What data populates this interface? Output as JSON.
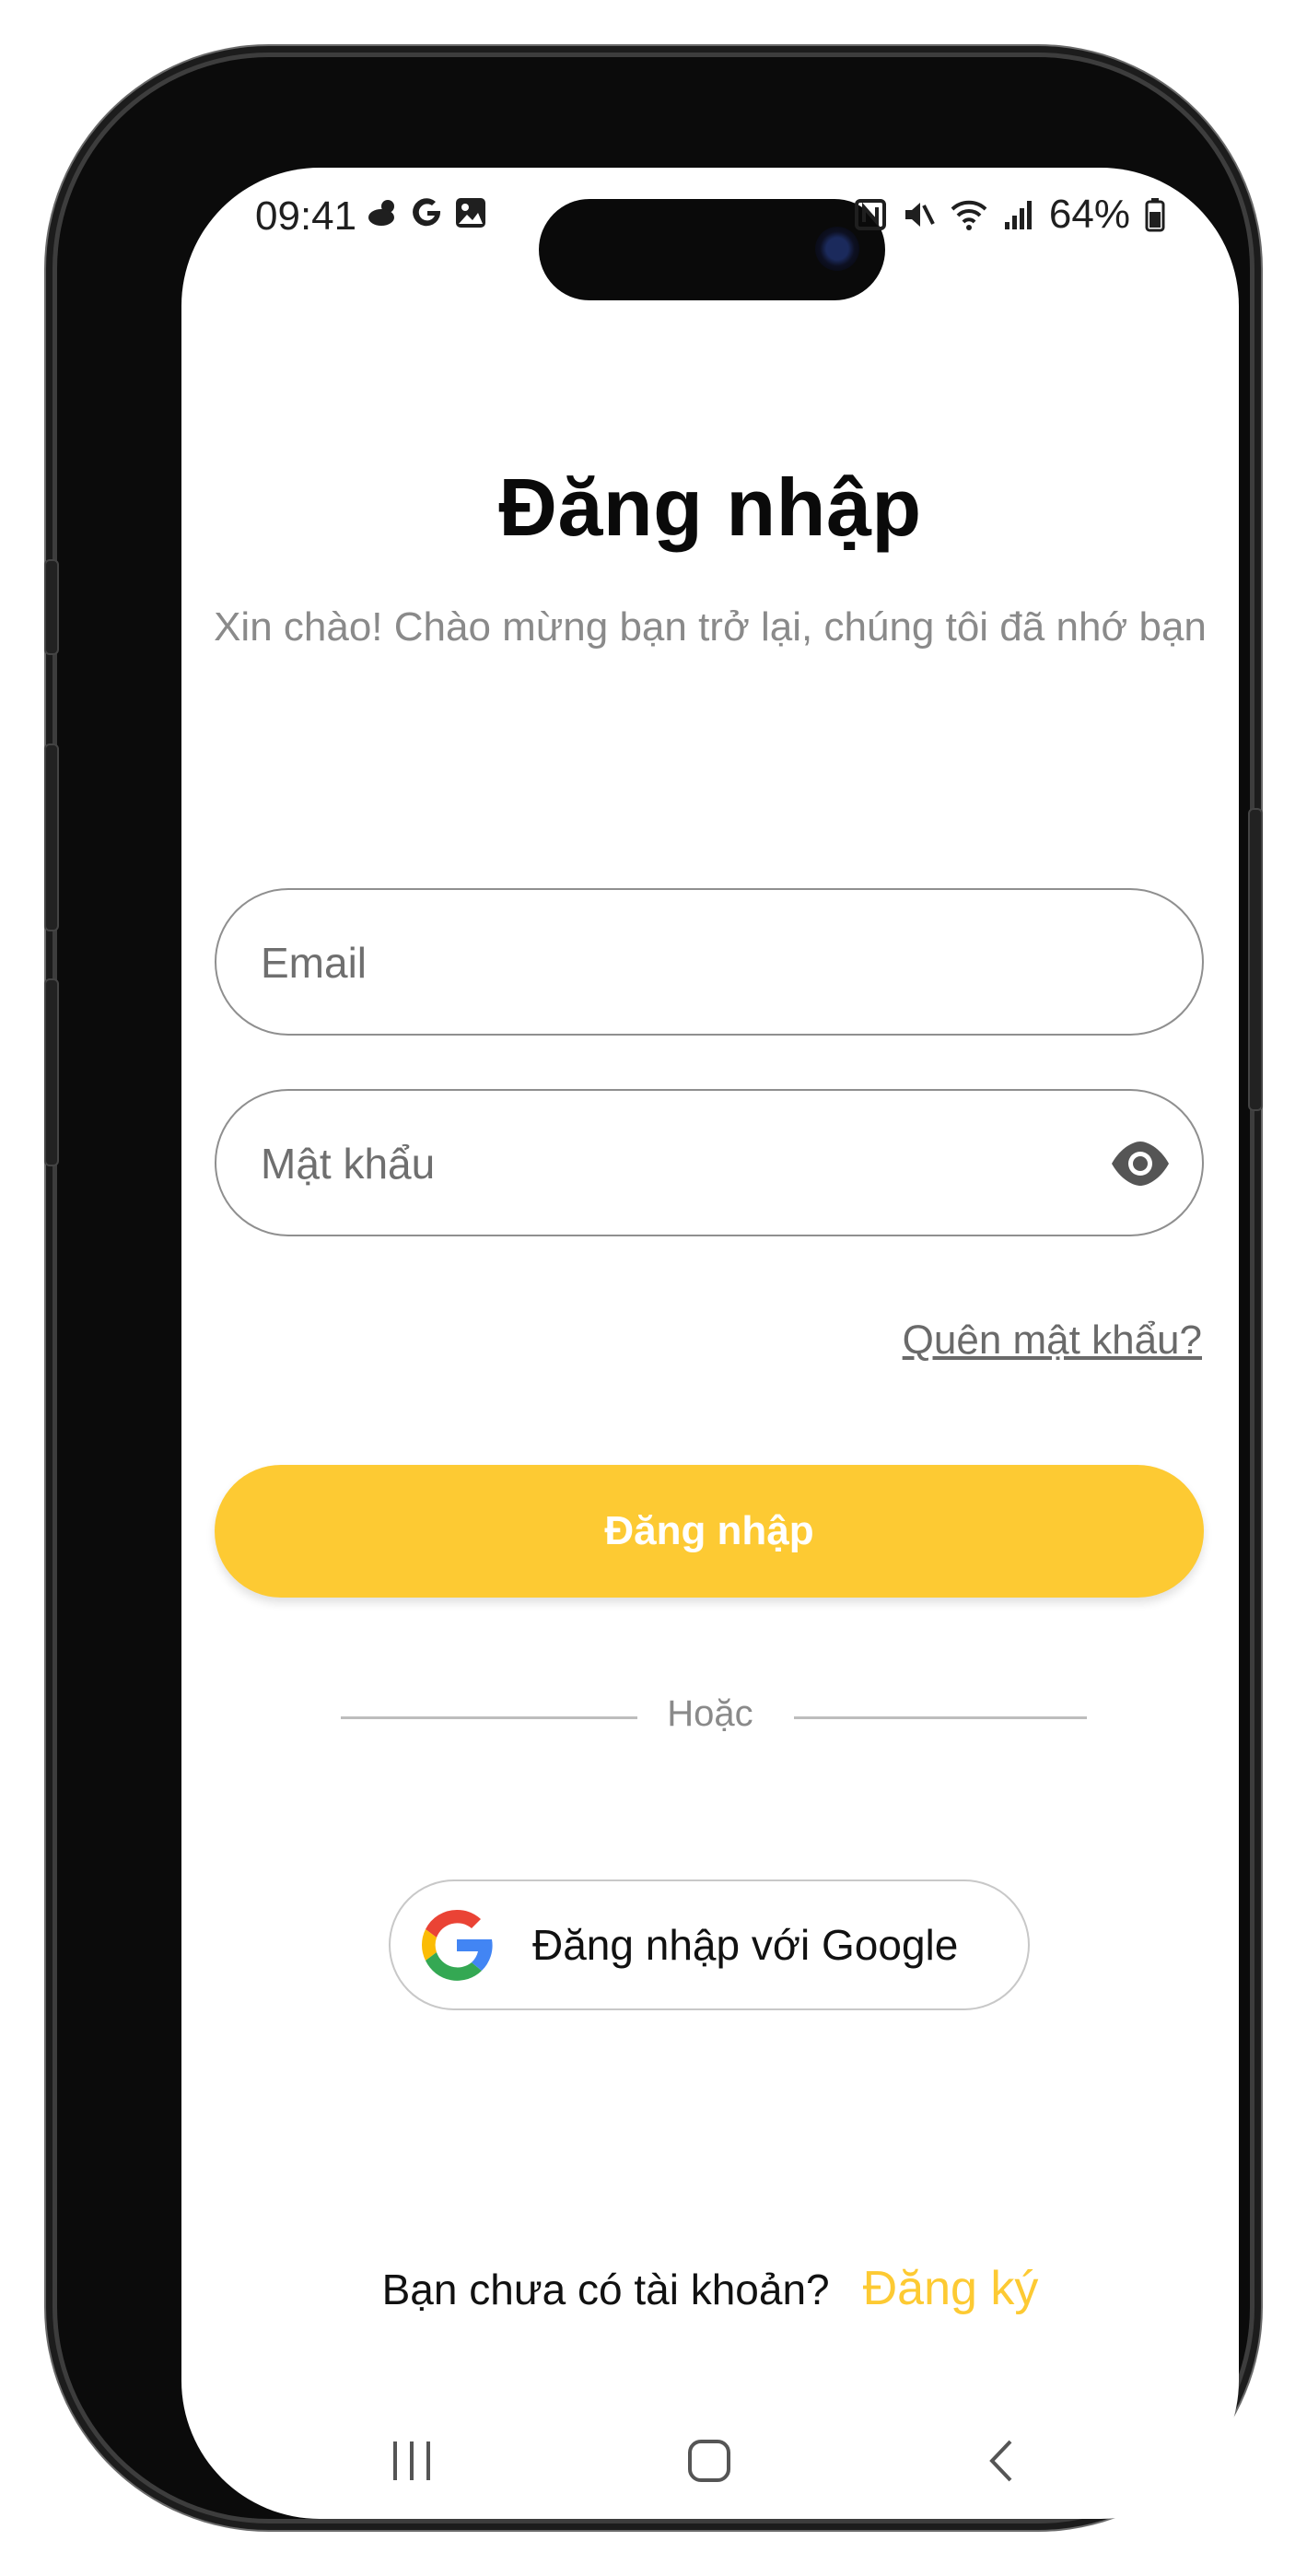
{
  "status_bar": {
    "time": "09:41",
    "battery": "64%",
    "left_icons": [
      "weather-icon",
      "google-g-icon",
      "gallery-icon"
    ],
    "right_icons": [
      "nfc-icon",
      "mute-icon",
      "wifi-icon",
      "signal-icon",
      "battery-icon"
    ]
  },
  "login": {
    "title": "Đăng nhập",
    "subtitle": "Xin chào! Chào mừng bạn trở lại, chúng tôi đã nhớ bạn",
    "email_placeholder": "Email",
    "password_placeholder": "Mật khẩu",
    "forgot_password": "Quên mật khẩu?",
    "login_button": "Đăng nhập",
    "divider_text": "Hoặc",
    "google_button": "Đăng nhập với Google",
    "signup_question": "Bạn chưa có tài khoản?",
    "signup_link": "Đăng ký"
  },
  "colors": {
    "accent": "#fdca33",
    "subtitle": "#8a8a8a",
    "border": "#8f8f8f"
  },
  "nav_bar": [
    "recents-icon",
    "home-icon",
    "back-icon"
  ]
}
